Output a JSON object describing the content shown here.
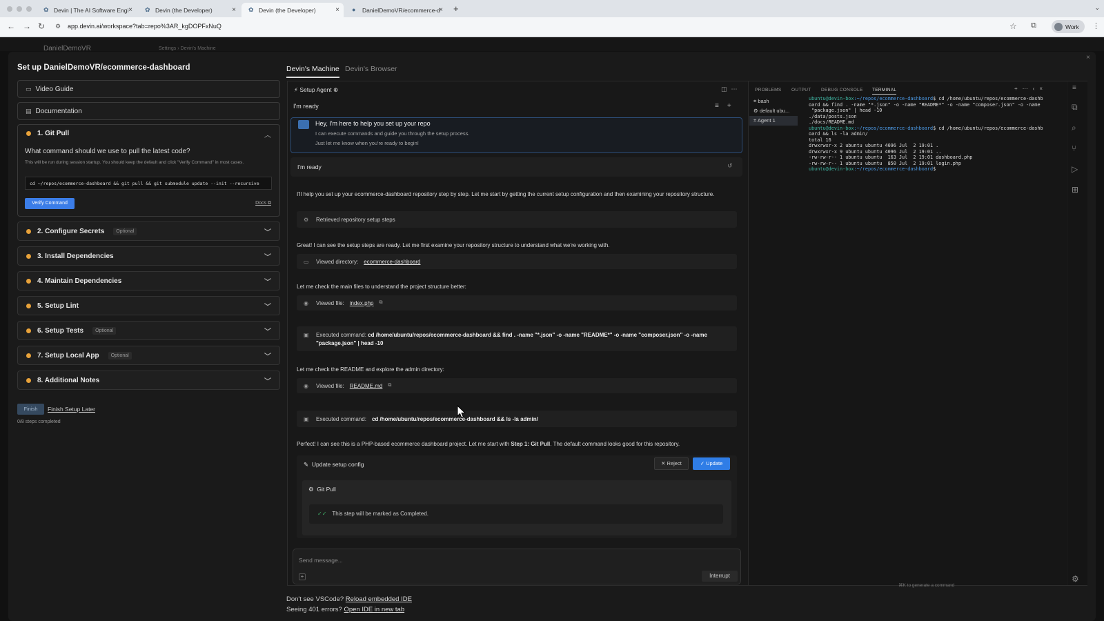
{
  "browser": {
    "tabs": [
      {
        "label": "Devin | The AI Software Engi"
      },
      {
        "label": "Devin (the Developer)"
      },
      {
        "label": "Devin (the Developer)"
      },
      {
        "label": "DanielDemoVR/ecommerce-d"
      }
    ],
    "url": "app.devin.ai/workspace?tab=repo%3AR_kgDOPFxNuQ",
    "profile": "Work"
  },
  "appbar": {
    "org": "DanielDemoVR",
    "crumb": "Settings  ›  Devin's Machine"
  },
  "setup": {
    "title": "Set up DanielDemoVR/ecommerce-dashboard",
    "video_guide": "Video Guide",
    "documentation": "Documentation",
    "step1": {
      "label": "1. Git Pull",
      "question": "What command should we use to pull the latest code?",
      "help": "This will be run during session startup. You should keep the default and click \"Verify Command\" in most cases.",
      "command": "cd ~/repos/ecommerce-dashboard && git pull && git submodule update --init --recursive",
      "verify": "Verify Command",
      "docs": "Docs"
    },
    "steps": [
      {
        "label": "2. Configure Secrets",
        "badge": "Optional"
      },
      {
        "label": "3. Install Dependencies",
        "badge": ""
      },
      {
        "label": "4. Maintain Dependencies",
        "badge": ""
      },
      {
        "label": "5. Setup Lint",
        "badge": ""
      },
      {
        "label": "6. Setup Tests",
        "badge": "Optional"
      },
      {
        "label": "7. Setup Local App",
        "badge": "Optional"
      },
      {
        "label": "8. Additional Notes",
        "badge": ""
      }
    ],
    "finish": "Finish",
    "finish_later": "Finish Setup Later",
    "progress": "0/8 steps completed"
  },
  "machine_tabs": {
    "active": "Devin's Machine",
    "other": "Devin's Browser"
  },
  "agent": {
    "tab": "Setup Agent",
    "header": "I'm ready",
    "greeting": {
      "l1": "Hey, I'm here to help you set up your repo",
      "l2": "I can execute commands and guide you through the setup process.",
      "l3": "Just let me know when you're ready to begin!"
    },
    "user_msg": "I'm ready",
    "p1": "I'll help you set up your ecommerce-dashboard repository step by step. Let me start by getting the current setup configuration and then examining your repository structure.",
    "t1": "Retrieved repository setup steps",
    "p2": "Great! I can see the setup steps are ready. Let me first examine your repository structure to understand what we're working with.",
    "t2_prefix": "Viewed directory:",
    "t2_link": "ecommerce-dashboard",
    "p3": "Let me check the main files to understand the project structure better:",
    "t3_prefix": "Viewed file:",
    "t3_link": "index.php",
    "t4_prefix": "Executed command:",
    "t4_cmd": "cd /home/ubuntu/repos/ecommerce-dashboard && find . -name \"*.json\" -o -name \"README*\" -o -name \"composer.json\" -o -name \"package.json\" | head -10",
    "p4": "Let me check the README and explore the admin directory:",
    "t5_prefix": "Viewed file:",
    "t5_link": "README.md",
    "t6_prefix": "Executed command:",
    "t6_cmd": "cd /home/ubuntu/repos/ecommerce-dashboard && ls -la admin/",
    "p5_a": "Perfect! I can see this is a PHP-based ecommerce dashboard project. Let me start with ",
    "p5_b": "Step 1: Git Pull",
    "p5_c": ". The default command looks good for this repository.",
    "update_title": "Update setup config",
    "reject": "Reject",
    "update": "Update",
    "gitpull": "Git Pull",
    "completed": "This step will be marked as Completed.",
    "composer_placeholder": "Send message...",
    "interrupt": "Interrupt"
  },
  "footer": {
    "q1": "Don't see VSCode?",
    "l1": "Reload embedded IDE",
    "q2": "Seeing 401 errors?",
    "l2": "Open IDE in new tab"
  },
  "terminal": {
    "tabs": [
      "PROBLEMS",
      "OUTPUT",
      "DEBUG CONSOLE",
      "TERMINAL"
    ],
    "list": [
      "bash",
      "default  ubu...",
      "Agent 1"
    ],
    "prompt": "ubuntu@devin-box",
    "path": ":~/repos/ecommerce-dashboard",
    "cmd1": "$ cd /home/ubuntu/repos/ecommerce-dashb\noard && find . -name \"*.json\" -o -name \"README*\" -o -name \"composer.json\" -o -name\n \"package.json\" | head -10\n./data/posts.json\n./docs/README.md",
    "cmd2": "$ cd /home/ubuntu/repos/ecommerce-dashb\noard && ls -la admin/\ntotal 16\ndrwxrwxr-x 2 ubuntu ubuntu 4096 Jul  2 19:01 .\ndrwxrwxr-x 9 ubuntu ubuntu 4096 Jul  2 19:01 ..\n-rw-rw-r-- 1 ubuntu ubuntu  163 Jul  2 19:01 dashboard.php\n-rw-rw-r-- 1 ubuntu ubuntu  850 Jul  2 19:01 login.php",
    "hint": "⌘K to generate a command"
  }
}
